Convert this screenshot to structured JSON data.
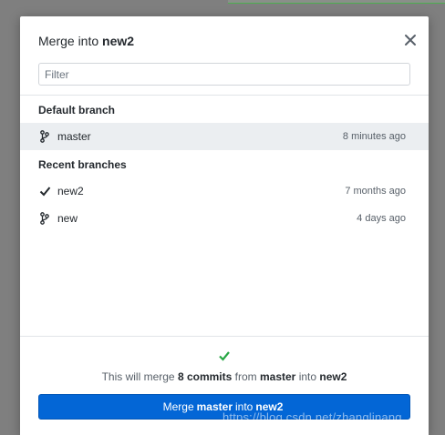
{
  "dialog": {
    "title_prefix": "Merge into",
    "title_branch": "new2",
    "filter_placeholder": "Filter",
    "default_section_title": "Default branch",
    "recent_section_title": "Recent branches",
    "default_branches": [
      {
        "name": "master",
        "time": "8 minutes ago",
        "icon": "git-branch-icon",
        "selected": true
      }
    ],
    "recent_branches": [
      {
        "name": "new2",
        "time": "7 months ago",
        "icon": "check-icon"
      },
      {
        "name": "new",
        "time": "4 days ago",
        "icon": "git-branch-icon"
      }
    ],
    "summary": {
      "prefix": "This will merge",
      "commits": "8 commits",
      "from_word": "from",
      "source": "master",
      "into_word": "into",
      "target": "new2"
    },
    "merge_button": {
      "prefix": "Merge",
      "source": "master",
      "middle": "into",
      "target": "new2"
    }
  },
  "watermark": "https://blog.csdn.net/zhanglinang",
  "colors": {
    "accent": "#0366d6",
    "success": "#28a745",
    "selected_row": "#ebeef1",
    "overlay": "#7f7f7f"
  }
}
